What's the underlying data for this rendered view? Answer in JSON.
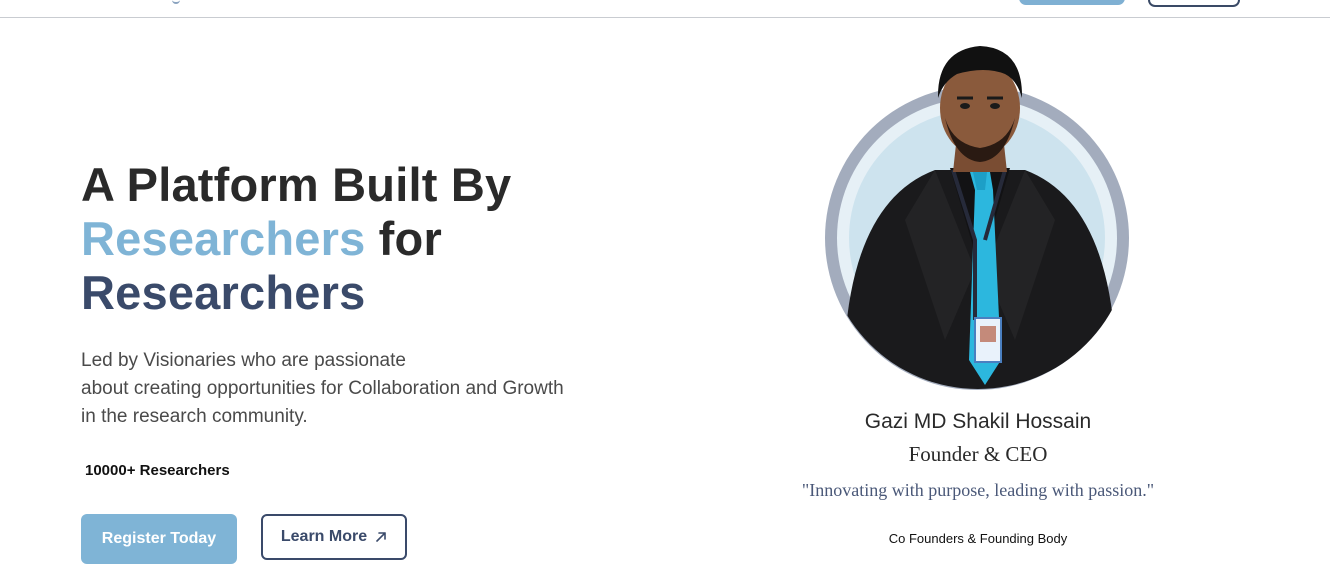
{
  "hero": {
    "headline_line1": "A Platform Built By",
    "headline_accent": "Researchers",
    "headline_for": " for",
    "headline_line3": "Researchers",
    "subtext": [
      "Led by Visionaries who are passionate",
      "about creating opportunities for Collaboration and Growth",
      "in the research community."
    ],
    "researcher_count": "10000+ Researchers",
    "register_label": "Register Today",
    "learn_more_label": "Learn More",
    "learn_more_icon": "arrow-up-right-icon"
  },
  "founder": {
    "name": "Gazi MD Shakil Hossain",
    "role": "Founder & CEO",
    "quote": "\"Innovating with purpose, leading with passion.\"",
    "section_label": "Co Founders & Founding Body"
  },
  "colors": {
    "accent": "#7fb4d6",
    "dark_navy": "#3a4a6a",
    "text": "#2a2a2a"
  }
}
